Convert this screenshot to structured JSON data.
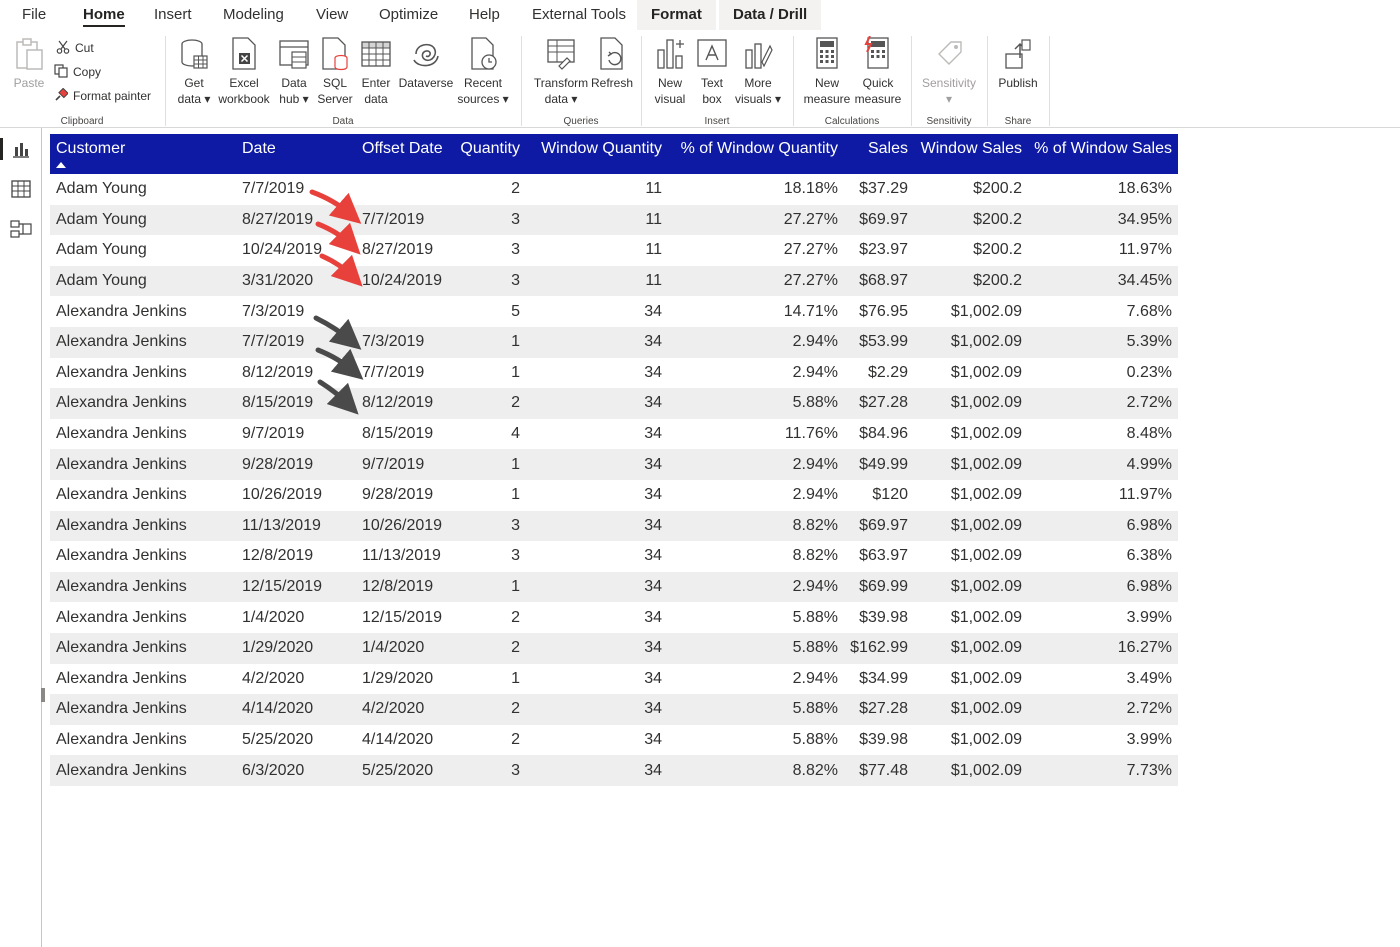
{
  "menu": {
    "tabs": [
      "File",
      "Home",
      "Insert",
      "Modeling",
      "View",
      "Optimize",
      "Help",
      "External Tools",
      "Format",
      "Data / Drill"
    ],
    "active": "Home"
  },
  "ribbon": {
    "clipboard": {
      "label": "Clipboard",
      "paste": "Paste",
      "cut": "Cut",
      "copy": "Copy",
      "format_painter": "Format painter"
    },
    "data": {
      "label": "Data",
      "get_data": "Get\ndata ▾",
      "excel": "Excel\nworkbook",
      "data_hub": "Data\nhub ▾",
      "sql": "SQL\nServer",
      "enter": "Enter\ndata",
      "dataverse": "Dataverse",
      "recent": "Recent\nsources ▾"
    },
    "queries": {
      "label": "Queries",
      "transform": "Transform\ndata ▾",
      "refresh": "Refresh"
    },
    "insert": {
      "label": "Insert",
      "new_visual": "New\nvisual",
      "text_box": "Text\nbox",
      "more_visuals": "More\nvisuals ▾"
    },
    "calculations": {
      "label": "Calculations",
      "new_measure": "New\nmeasure",
      "quick_measure": "Quick\nmeasure"
    },
    "sensitivity": {
      "label": "Sensitivity",
      "button": "Sensitivity\n▾"
    },
    "share": {
      "label": "Share",
      "publish": "Publish"
    }
  },
  "colors": {
    "header_bg": "#0e1aa3",
    "stripe": "#eeeeee",
    "arrow_red": "#e8413c",
    "arrow_dark": "#4a4a4a"
  },
  "table": {
    "columns": [
      "Customer",
      "Date",
      "Offset Date",
      "Quantity",
      "Window Quantity",
      "% of Window Quantity",
      "Sales",
      "Window Sales",
      "% of Window Sales"
    ],
    "rows": [
      [
        "Adam Young",
        "7/7/2019",
        "",
        "2",
        "11",
        "18.18%",
        "$37.29",
        "$200.2",
        "18.63%"
      ],
      [
        "Adam Young",
        "8/27/2019",
        "7/7/2019",
        "3",
        "11",
        "27.27%",
        "$69.97",
        "$200.2",
        "34.95%"
      ],
      [
        "Adam Young",
        "10/24/2019",
        "8/27/2019",
        "3",
        "11",
        "27.27%",
        "$23.97",
        "$200.2",
        "11.97%"
      ],
      [
        "Adam Young",
        "3/31/2020",
        "10/24/2019",
        "3",
        "11",
        "27.27%",
        "$68.97",
        "$200.2",
        "34.45%"
      ],
      [
        "Alexandra Jenkins",
        "7/3/2019",
        "",
        "5",
        "34",
        "14.71%",
        "$76.95",
        "$1,002.09",
        "7.68%"
      ],
      [
        "Alexandra Jenkins",
        "7/7/2019",
        "7/3/2019",
        "1",
        "34",
        "2.94%",
        "$53.99",
        "$1,002.09",
        "5.39%"
      ],
      [
        "Alexandra Jenkins",
        "8/12/2019",
        "7/7/2019",
        "1",
        "34",
        "2.94%",
        "$2.29",
        "$1,002.09",
        "0.23%"
      ],
      [
        "Alexandra Jenkins",
        "8/15/2019",
        "8/12/2019",
        "2",
        "34",
        "5.88%",
        "$27.28",
        "$1,002.09",
        "2.72%"
      ],
      [
        "Alexandra Jenkins",
        "9/7/2019",
        "8/15/2019",
        "4",
        "34",
        "11.76%",
        "$84.96",
        "$1,002.09",
        "8.48%"
      ],
      [
        "Alexandra Jenkins",
        "9/28/2019",
        "9/7/2019",
        "1",
        "34",
        "2.94%",
        "$49.99",
        "$1,002.09",
        "4.99%"
      ],
      [
        "Alexandra Jenkins",
        "10/26/2019",
        "9/28/2019",
        "1",
        "34",
        "2.94%",
        "$120",
        "$1,002.09",
        "11.97%"
      ],
      [
        "Alexandra Jenkins",
        "11/13/2019",
        "10/26/2019",
        "3",
        "34",
        "8.82%",
        "$69.97",
        "$1,002.09",
        "6.98%"
      ],
      [
        "Alexandra Jenkins",
        "12/8/2019",
        "11/13/2019",
        "3",
        "34",
        "8.82%",
        "$63.97",
        "$1,002.09",
        "6.38%"
      ],
      [
        "Alexandra Jenkins",
        "12/15/2019",
        "12/8/2019",
        "1",
        "34",
        "2.94%",
        "$69.99",
        "$1,002.09",
        "6.98%"
      ],
      [
        "Alexandra Jenkins",
        "1/4/2020",
        "12/15/2019",
        "2",
        "34",
        "5.88%",
        "$39.98",
        "$1,002.09",
        "3.99%"
      ],
      [
        "Alexandra Jenkins",
        "1/29/2020",
        "1/4/2020",
        "2",
        "34",
        "5.88%",
        "$162.99",
        "$1,002.09",
        "16.27%"
      ],
      [
        "Alexandra Jenkins",
        "4/2/2020",
        "1/29/2020",
        "1",
        "34",
        "2.94%",
        "$34.99",
        "$1,002.09",
        "3.49%"
      ],
      [
        "Alexandra Jenkins",
        "4/14/2020",
        "4/2/2020",
        "2",
        "34",
        "5.88%",
        "$27.28",
        "$1,002.09",
        "2.72%"
      ],
      [
        "Alexandra Jenkins",
        "5/25/2020",
        "4/14/2020",
        "2",
        "34",
        "5.88%",
        "$39.98",
        "$1,002.09",
        "3.99%"
      ],
      [
        "Alexandra Jenkins",
        "6/3/2020",
        "5/25/2020",
        "3",
        "34",
        "8.82%",
        "$77.48",
        "$1,002.09",
        "7.73%"
      ]
    ]
  }
}
